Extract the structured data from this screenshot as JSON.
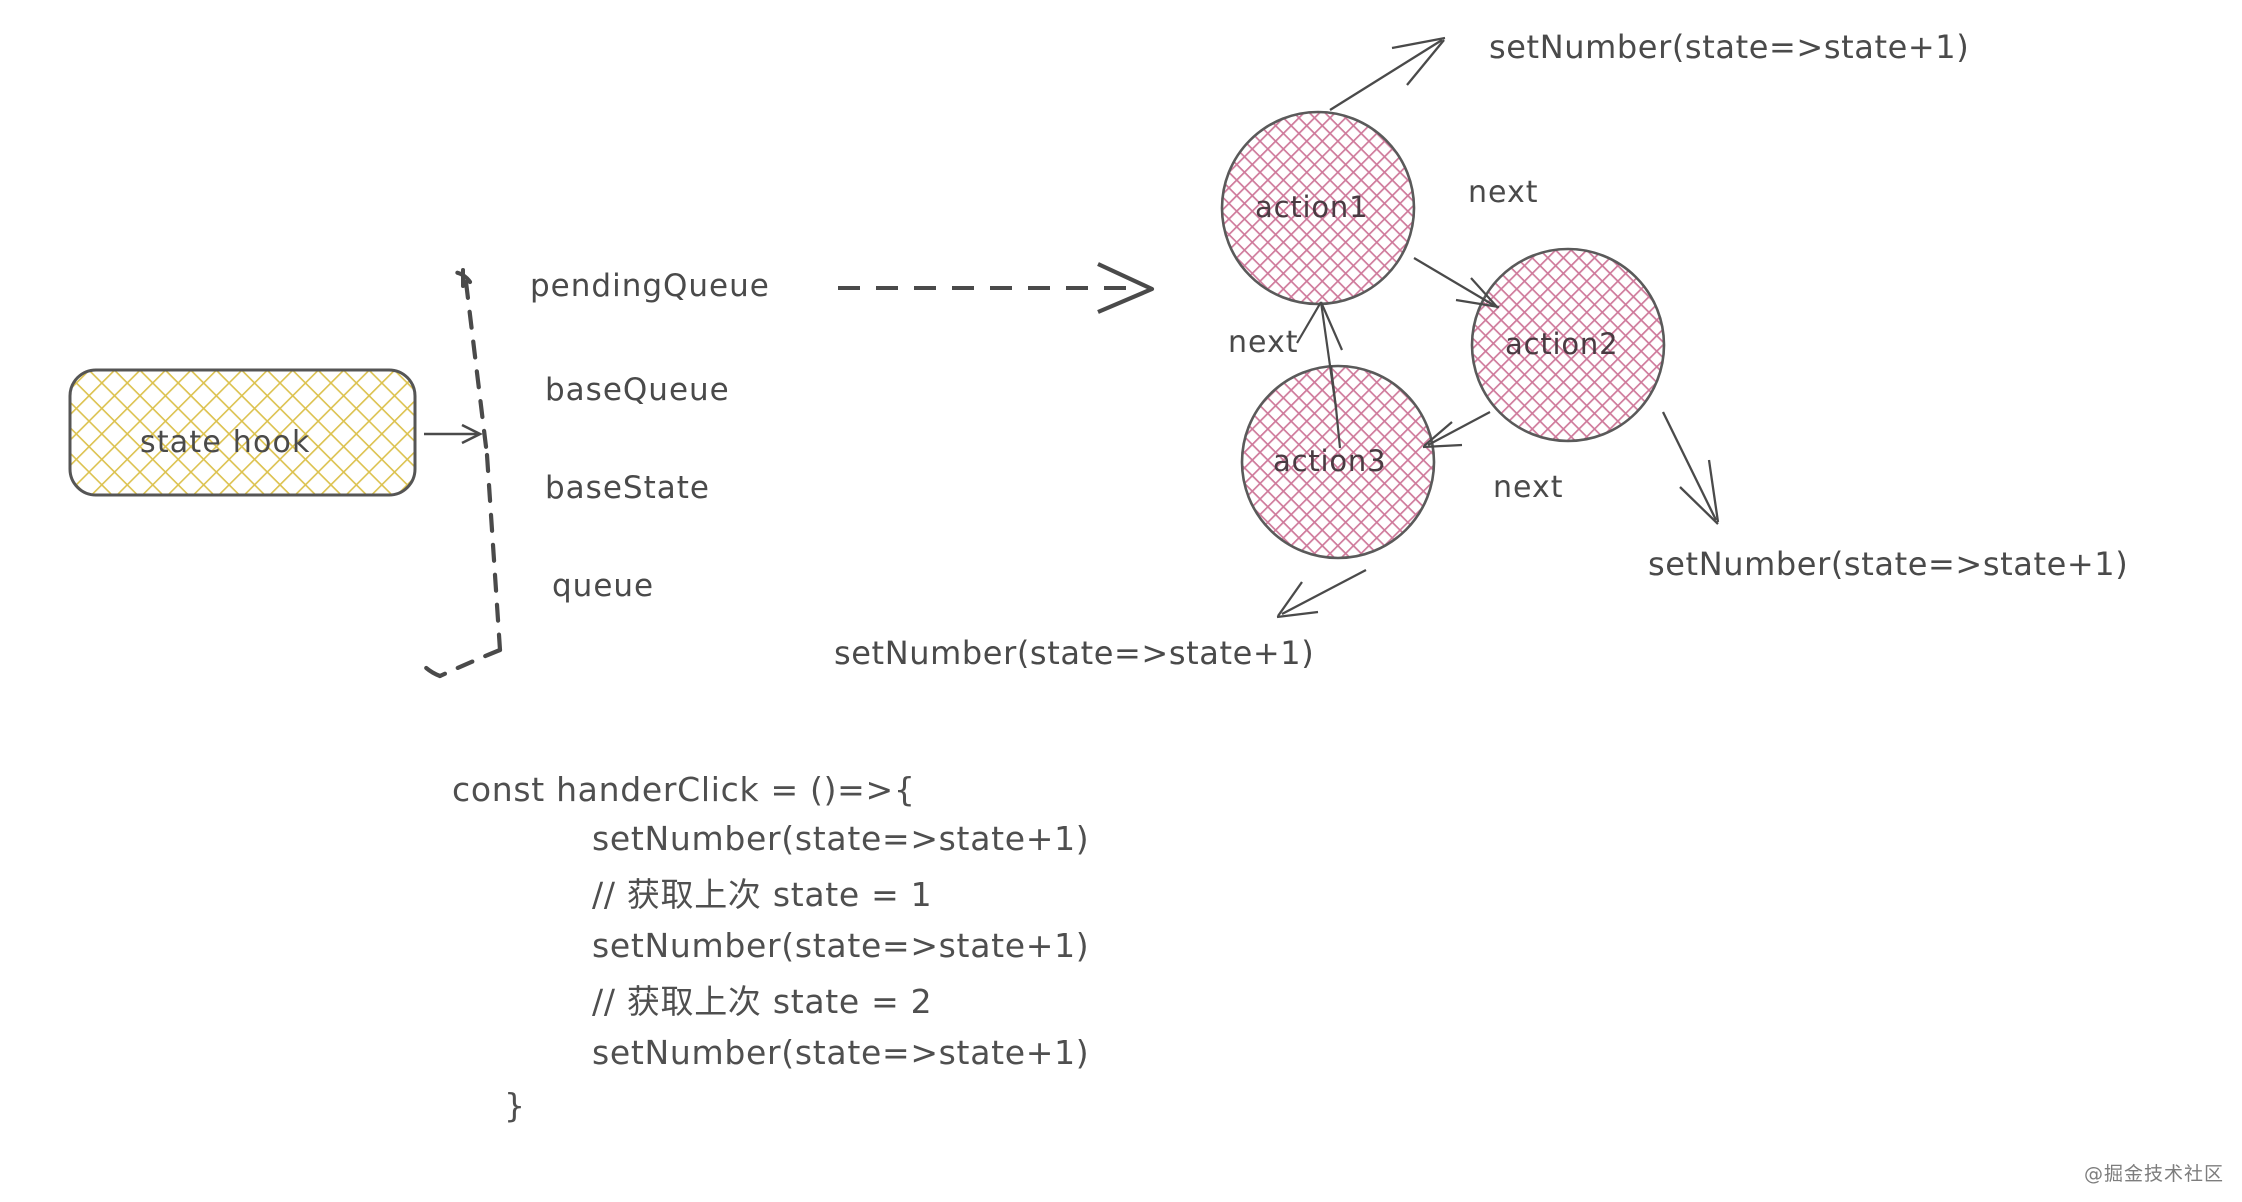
{
  "diagram": {
    "title_context": "React useState hook pendingQueue circular linked list diagram",
    "state_box": {
      "label": "state hook",
      "fill_pattern_color": "#dcc24f",
      "border_color": "#555555"
    },
    "properties": [
      {
        "label": "pendingQueue"
      },
      {
        "label": "baseQueue"
      },
      {
        "label": "baseState"
      },
      {
        "label": "queue"
      }
    ],
    "nodes": [
      {
        "id": "action1",
        "label": "action1"
      },
      {
        "id": "action2",
        "label": "action2"
      },
      {
        "id": "action3",
        "label": "action3"
      }
    ],
    "node_style": {
      "fill_pattern_color": "#cf7a9b",
      "border_color": "#5a5a5a"
    },
    "edge_labels": [
      {
        "id": "next-1-2",
        "label": "next"
      },
      {
        "id": "next-3-1",
        "label": "next"
      },
      {
        "id": "next-2-3",
        "label": "next"
      }
    ],
    "callouts": [
      {
        "id": "callout-top",
        "label": "setNumber(state=>state+1)"
      },
      {
        "id": "callout-right",
        "label": "setNumber(state=>state+1)"
      },
      {
        "id": "callout-bottom",
        "label": "setNumber(state=>state+1)"
      }
    ],
    "code": {
      "lines": [
        {
          "id": "line-1",
          "text": "const handerClick = ()=>{",
          "indent": 0
        },
        {
          "id": "line-2",
          "text": "setNumber(state=>state+1)",
          "indent": 1
        },
        {
          "id": "line-3",
          "text": "// 获取上次 state = 1",
          "indent": 1
        },
        {
          "id": "line-4",
          "text": "setNumber(state=>state+1)",
          "indent": 1
        },
        {
          "id": "line-5",
          "text": "// 获取上次 state = 2",
          "indent": 1
        },
        {
          "id": "line-6",
          "text": "setNumber(state=>state+1)",
          "indent": 1
        },
        {
          "id": "line-7",
          "text": "}",
          "indent": 0
        }
      ]
    },
    "watermark": "@掘金技术社区",
    "colors": {
      "background": "#ffffff",
      "ink": "#4a4a4a",
      "pink": "#cf7a9b",
      "gold": "#dcc24f"
    }
  }
}
